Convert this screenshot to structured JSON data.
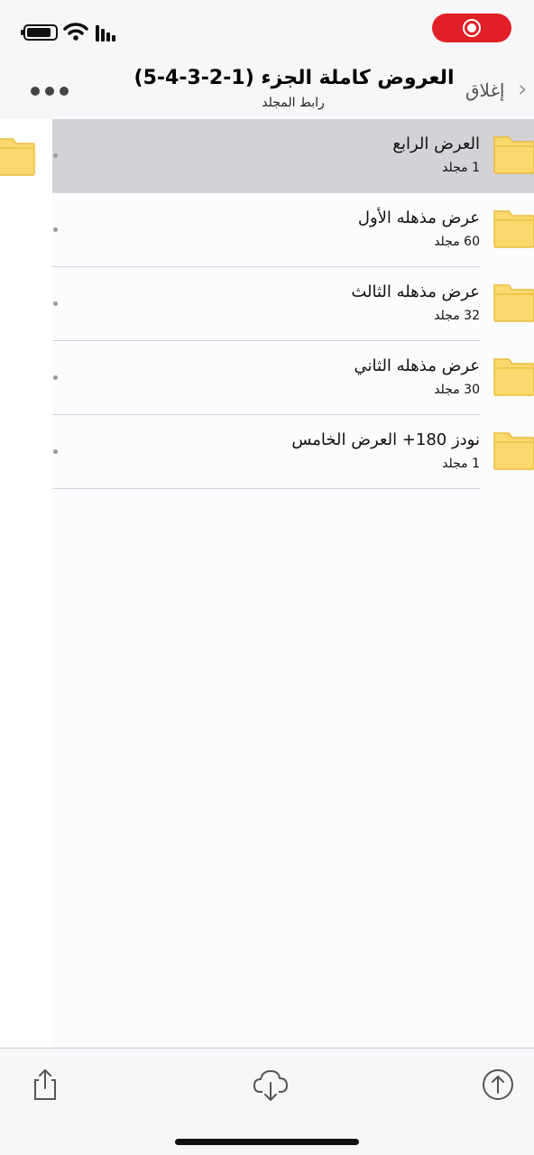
{
  "status_bar": {
    "record_color": "#e11f26"
  },
  "nav": {
    "title": "العروض كاملة الجزء (1-2-3-4-5)",
    "subtitle": "رابط المجلد",
    "close_label": "إغلاق"
  },
  "folders": [
    {
      "name": "العرض الرابع",
      "count": "1 مجلد",
      "selected": true
    },
    {
      "name": "عرض مذهله الأول",
      "count": "60 مجلد",
      "selected": false
    },
    {
      "name": "عرض مذهله الثالث",
      "count": "32 مجلد",
      "selected": false
    },
    {
      "name": "عرض مذهله الثاني",
      "count": "30 مجلد",
      "selected": false
    },
    {
      "name": "نودز 180+ العرض الخامس",
      "count": "1 مجلد",
      "selected": false
    }
  ],
  "toolbar": {
    "icons": [
      "upload-icon",
      "cloud-download-icon",
      "share-icon"
    ]
  },
  "colors": {
    "folder": "#fbd96e",
    "folder_border": "#e8bd3f",
    "selection": "#d3d2d6"
  }
}
